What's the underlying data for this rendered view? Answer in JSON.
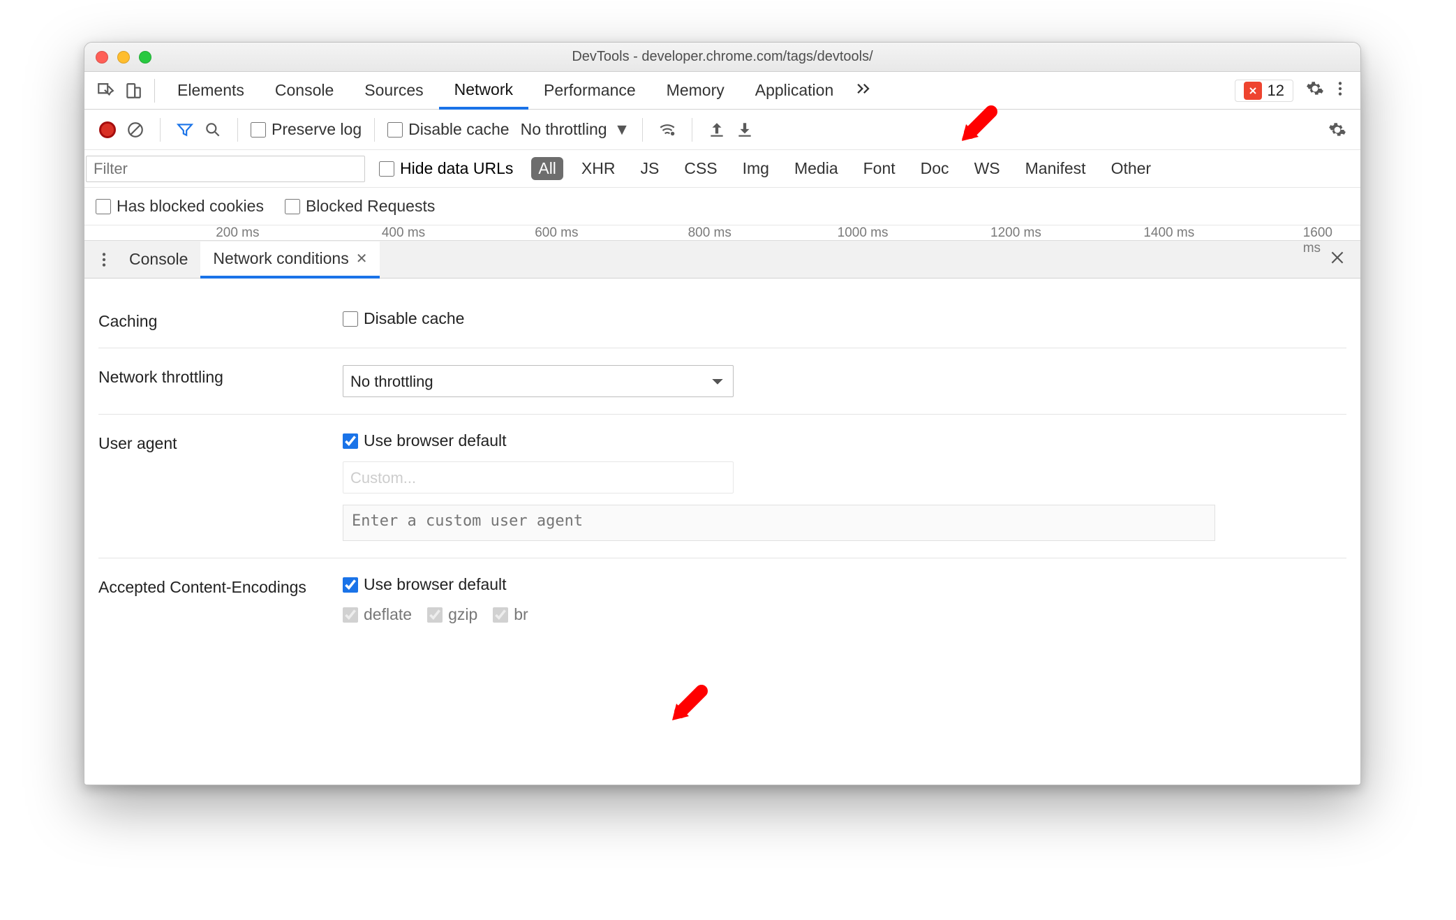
{
  "window": {
    "title": "DevTools - developer.chrome.com/tags/devtools/"
  },
  "panels": {
    "items": [
      "Elements",
      "Console",
      "Sources",
      "Network",
      "Performance",
      "Memory",
      "Application"
    ],
    "active_index": 3,
    "error_count": "12"
  },
  "network_toolbar": {
    "preserve_log": "Preserve log",
    "disable_cache": "Disable cache",
    "throttling": "No throttling"
  },
  "filter": {
    "placeholder": "Filter",
    "hide_data_urls": "Hide data URLs",
    "types": [
      "All",
      "XHR",
      "JS",
      "CSS",
      "Img",
      "Media",
      "Font",
      "Doc",
      "WS",
      "Manifest",
      "Other"
    ],
    "active_type_index": 0
  },
  "blocked": {
    "has_blocked_cookies": "Has blocked cookies",
    "blocked_requests": "Blocked Requests"
  },
  "timeline": {
    "ticks": [
      "200 ms",
      "400 ms",
      "600 ms",
      "800 ms",
      "1000 ms",
      "1200 ms",
      "1400 ms",
      "1600 ms"
    ]
  },
  "drawer": {
    "tabs": [
      "Console",
      "Network conditions"
    ],
    "active_index": 1
  },
  "conditions": {
    "caching_label": "Caching",
    "caching_checkbox": "Disable cache",
    "throttling_label": "Network throttling",
    "throttling_value": "No throttling",
    "ua_label": "User agent",
    "ua_checkbox": "Use browser default",
    "ua_select_placeholder": "Custom...",
    "ua_textarea_placeholder": "Enter a custom user agent",
    "enc_label": "Accepted Content-Encodings",
    "enc_checkbox": "Use browser default",
    "encodings": [
      "deflate",
      "gzip",
      "br"
    ]
  }
}
